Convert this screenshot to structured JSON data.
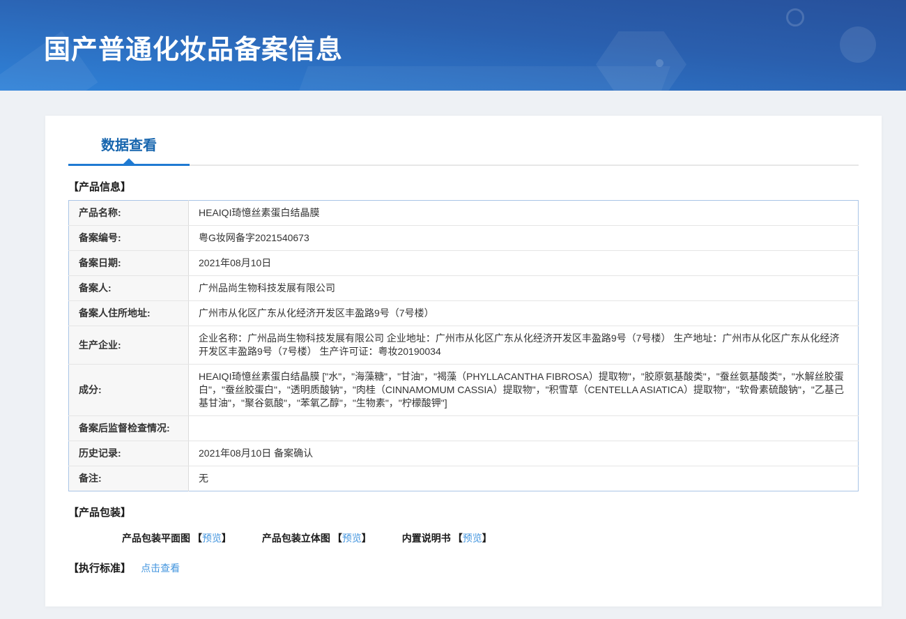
{
  "banner": {
    "title": "国产普通化妆品备案信息"
  },
  "tabs": {
    "data_view": "数据查看"
  },
  "sections": {
    "product_info_heading": "【产品信息】",
    "packaging_heading": "【产品包装】",
    "standard_heading": "【执行标准】",
    "standard_link": "点击查看"
  },
  "table": {
    "rows": [
      {
        "label": "产品名称:",
        "value": "HEAIQI琦憶丝素蛋白结晶膜"
      },
      {
        "label": "备案编号:",
        "value": "粤G妆网备字2021540673"
      },
      {
        "label": "备案日期:",
        "value": "2021年08月10日"
      },
      {
        "label": "备案人:",
        "value": "广州品尚生物科技发展有限公司"
      },
      {
        "label": "备案人住所地址:",
        "value": "广州市从化区广东从化经济开发区丰盈路9号（7号楼）"
      },
      {
        "label": "生产企业:",
        "value": "企业名称：广州品尚生物科技发展有限公司 企业地址：广州市从化区广东从化经济开发区丰盈路9号（7号楼）  生产地址：广州市从化区广东从化经济开发区丰盈路9号（7号楼）  生产许可证：粤妆20190034"
      },
      {
        "label": "成分:",
        "value": "HEAIQI琦憶丝素蛋白结晶膜 [\"水\"，\"海藻糖\"，\"甘油\"，\"褐藻（PHYLLACANTHA FIBROSA）提取物\"，\"胶原氨基酸类\"，\"蚕丝氨基酸类\"，\"水解丝胶蛋白\"，\"蚕丝胶蛋白\"，\"透明质酸钠\"，\"肉桂（CINNAMOMUM CASSIA）提取物\"，\"积雪草（CENTELLA ASIATICA）提取物\"，\"软骨素硫酸钠\"，\"乙基己基甘油\"，\"聚谷氨酸\"，\"苯氧乙醇\"，\"生物素\"，\"柠檬酸钾\"]"
      },
      {
        "label": "备案后监督检查情况:",
        "value": ""
      },
      {
        "label": "历史记录:",
        "value": "2021年08月10日 备案确认"
      },
      {
        "label": "备注:",
        "value": "无"
      }
    ]
  },
  "packaging": {
    "bracket_open": "【",
    "bracket_close": "】",
    "items": [
      {
        "label": "产品包装平面图",
        "link": "预览"
      },
      {
        "label": "产品包装立体图",
        "link": "预览"
      },
      {
        "label": "内置说明书",
        "link": "预览"
      }
    ]
  },
  "colors": {
    "banner_gradient_top": "#27519c",
    "banner_gradient_bottom": "#2f82d8",
    "tab_text": "#1866ae",
    "tab_underline": "#1f7ad2",
    "link": "#4496df",
    "table_border": "#a9c4e6",
    "label_cell_bg": "#f7f7f7",
    "page_bg": "#eef1f5"
  }
}
